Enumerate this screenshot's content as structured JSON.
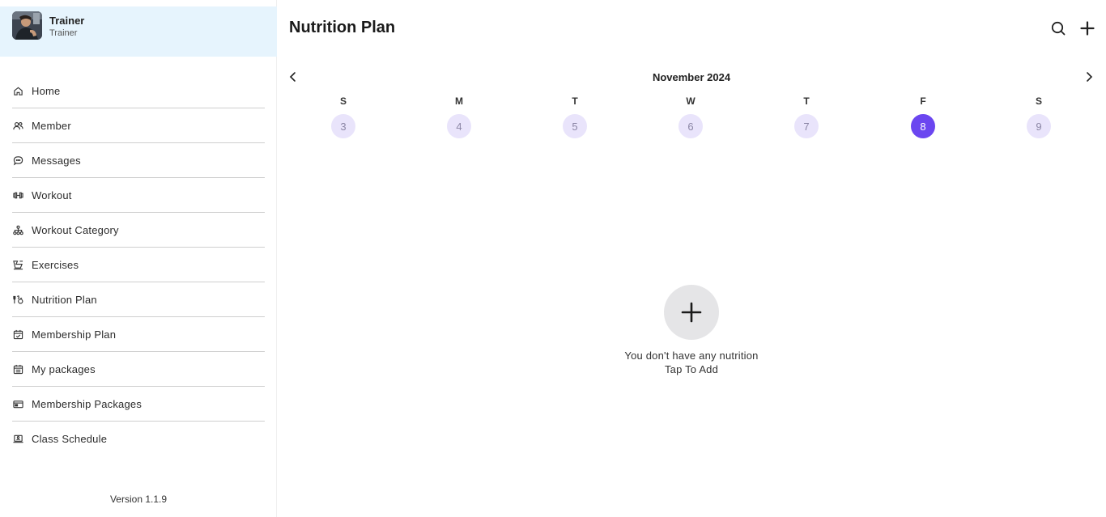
{
  "profile": {
    "name": "Trainer",
    "role": "Trainer",
    "avatar_icon": "user-avatar"
  },
  "sidebar": {
    "items": [
      {
        "label": "Home",
        "icon": "home-icon"
      },
      {
        "label": "Member",
        "icon": "users-icon"
      },
      {
        "label": "Messages",
        "icon": "chat-icon"
      },
      {
        "label": "Workout",
        "icon": "dumbbell-icon"
      },
      {
        "label": "Workout Category",
        "icon": "hierarchy-icon"
      },
      {
        "label": "Exercises",
        "icon": "treadmill-icon"
      },
      {
        "label": "Nutrition Plan",
        "icon": "nutrition-icon"
      },
      {
        "label": "Membership Plan",
        "icon": "calendar-check-icon"
      },
      {
        "label": "My packages",
        "icon": "calendar-list-icon"
      },
      {
        "label": "Membership Packages",
        "icon": "card-icon"
      },
      {
        "label": "Class Schedule",
        "icon": "laptop-user-icon"
      }
    ],
    "version": "Version 1.1.9"
  },
  "header": {
    "title": "Nutrition Plan",
    "search_icon": "search-icon",
    "add_icon": "plus-icon"
  },
  "calendar": {
    "month": "November 2024",
    "weekdays": [
      "S",
      "M",
      "T",
      "W",
      "T",
      "F",
      "S"
    ],
    "days": [
      "3",
      "4",
      "5",
      "6",
      "7",
      "8",
      "9"
    ],
    "selected_day": "8",
    "accent_color": "#6b46f0",
    "day_bg_color": "#e9e4fb"
  },
  "empty_state": {
    "line1": "You don't have any nutrition",
    "line2": "Tap To Add",
    "icon": "plus-icon"
  }
}
